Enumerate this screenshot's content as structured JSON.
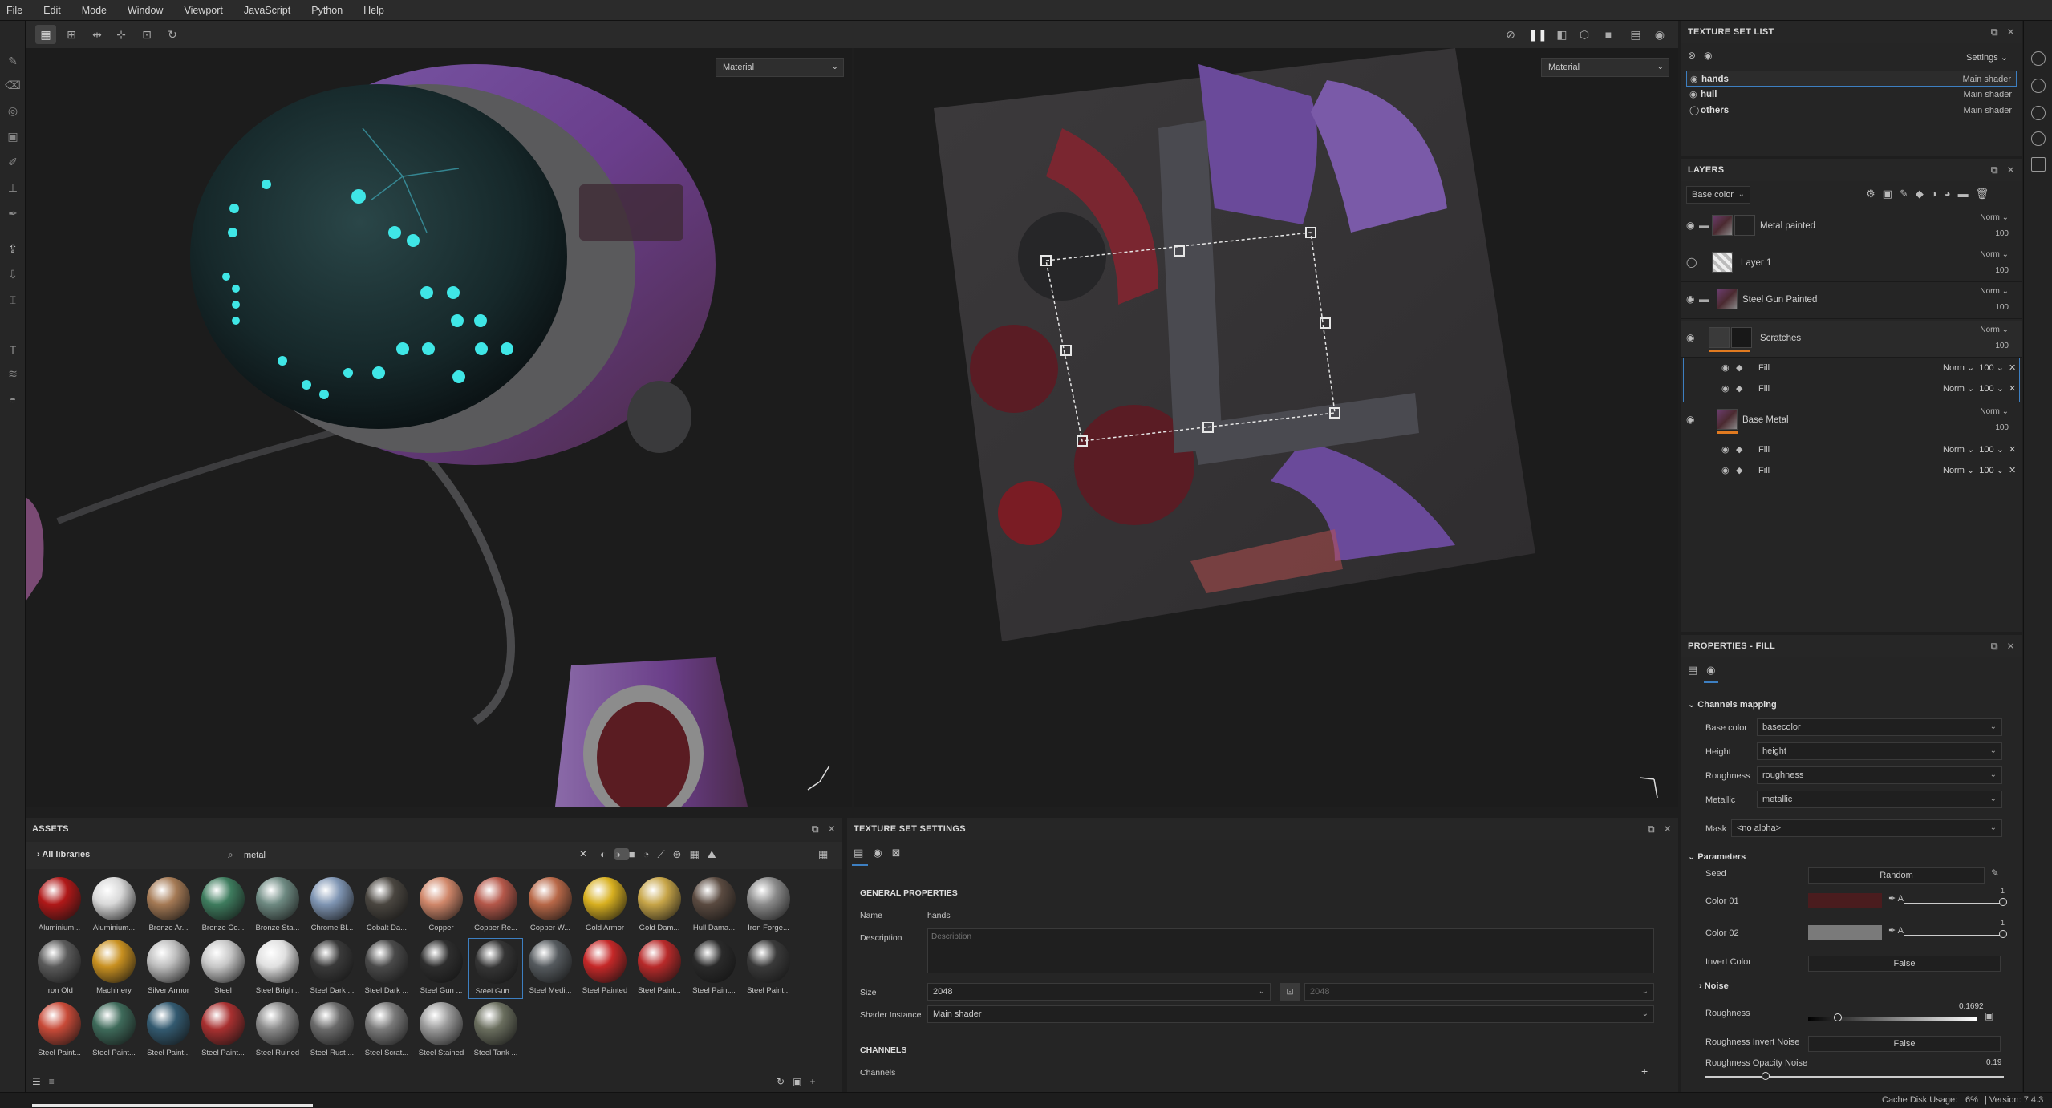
{
  "menu": [
    "File",
    "Edit",
    "Mode",
    "Window",
    "Viewport",
    "JavaScript",
    "Python",
    "Help"
  ],
  "viewport": {
    "left_select": "Material",
    "right_select": "Material"
  },
  "texture_set_list": {
    "title": "TEXTURE SET LIST",
    "settings_label": "Settings",
    "sets": [
      {
        "name": "hands",
        "shader": "Main shader",
        "selected": true
      },
      {
        "name": "hull",
        "shader": "Main shader",
        "selected": false
      },
      {
        "name": "others",
        "shader": "Main shader",
        "selected": false
      }
    ]
  },
  "layers": {
    "title": "LAYERS",
    "channel_select": "Base color",
    "items": [
      {
        "name": "Metal painted",
        "blend": "Norm",
        "opacity": "100"
      },
      {
        "name": "Layer 1",
        "blend": "Norm",
        "opacity": "100"
      },
      {
        "name": "Steel Gun Painted",
        "blend": "Norm",
        "opacity": "100"
      },
      {
        "name": "Scratches",
        "blend": "Norm",
        "opacity": "100"
      },
      {
        "name": "Base Metal",
        "blend": "Norm",
        "opacity": "100"
      }
    ],
    "scratches_fills": [
      {
        "name": "Fill",
        "blend": "Norm",
        "opacity": "100"
      },
      {
        "name": "Fill",
        "blend": "Norm",
        "opacity": "100"
      }
    ],
    "base_fills": [
      {
        "name": "Fill",
        "blend": "Norm",
        "opacity": "100"
      },
      {
        "name": "Fill",
        "blend": "Norm",
        "opacity": "100"
      }
    ]
  },
  "properties": {
    "title": "PROPERTIES - FILL",
    "channels_mapping_title": "Channels mapping",
    "mapping": [
      {
        "label": "Base color",
        "value": "basecolor"
      },
      {
        "label": "Height",
        "value": "height"
      },
      {
        "label": "Roughness",
        "value": "roughness"
      },
      {
        "label": "Metallic",
        "value": "metallic"
      }
    ],
    "mask_label": "Mask",
    "mask_value": "<no alpha>",
    "parameters_title": "Parameters",
    "seed_label": "Seed",
    "seed_value": "Random",
    "color01_label": "Color 01",
    "color01": "#4a1c1e",
    "color02_label": "Color 02",
    "color02": "#7a7a7a",
    "alpha_label": "A",
    "alpha_max": "1",
    "invert_color_label": "Invert Color",
    "invert_color_value": "False",
    "noise_label": "Noise",
    "roughness_label": "Roughness",
    "roughness_value": "0.1692",
    "roughness_invert_label": "Roughness Invert Noise",
    "roughness_invert_value": "False",
    "roughness_opacity_label": "Roughness Opacity Noise",
    "roughness_opacity_value": "0.19"
  },
  "assets": {
    "title": "ASSETS",
    "library": "All libraries",
    "search_value": "metal",
    "materials": [
      {
        "label": "Aluminium...",
        "color": "#b01818"
      },
      {
        "label": "Aluminium...",
        "color": "#d8d8d8"
      },
      {
        "label": "Bronze Ar...",
        "color": "#a57a55"
      },
      {
        "label": "Bronze Co...",
        "color": "#3e7c5e"
      },
      {
        "label": "Bronze Sta...",
        "color": "#6e8a82"
      },
      {
        "label": "Chrome Bl...",
        "color": "#7f95b3"
      },
      {
        "label": "Cobalt Da...",
        "color": "#4a4640"
      },
      {
        "label": "Copper",
        "color": "#d0876a"
      },
      {
        "label": "Copper Re...",
        "color": "#b5584a"
      },
      {
        "label": "Copper W...",
        "color": "#b86848"
      },
      {
        "label": "Gold Armor",
        "color": "#d8b020"
      },
      {
        "label": "Gold Dam...",
        "color": "#c7a548"
      },
      {
        "label": "Hull Dama...",
        "color": "#5a4a40"
      },
      {
        "label": "Iron Forge...",
        "color": "#8a8a8a"
      },
      {
        "label": "Iron Old",
        "color": "#5a5a5a"
      },
      {
        "label": "Machinery",
        "color": "#c89020"
      },
      {
        "label": "Silver Armor",
        "color": "#bdbdbd"
      },
      {
        "label": "Steel",
        "color": "#c7c7c7"
      },
      {
        "label": "Steel Brigh...",
        "color": "#e0e0e0"
      },
      {
        "label": "Steel Dark ...",
        "color": "#3a3a3a"
      },
      {
        "label": "Steel Dark ...",
        "color": "#4a4a4a"
      },
      {
        "label": "Steel Gun ...",
        "color": "#2e2e2e"
      },
      {
        "label": "Steel Gun ...",
        "color": "#353535"
      },
      {
        "label": "Steel Medi...",
        "color": "#555a5e"
      },
      {
        "label": "Steel Painted",
        "color": "#c52828"
      },
      {
        "label": "Steel Paint...",
        "color": "#b82a2a"
      },
      {
        "label": "Steel Paint...",
        "color": "#2a2a2a"
      },
      {
        "label": "Steel Paint...",
        "color": "#3a3a3a"
      },
      {
        "label": "Steel Paint...",
        "color": "#c84a38"
      },
      {
        "label": "Steel Paint...",
        "color": "#3e6a5a"
      },
      {
        "label": "Steel Paint...",
        "color": "#335a70"
      },
      {
        "label": "Steel Paint...",
        "color": "#a83030"
      },
      {
        "label": "Steel Ruined",
        "color": "#8a8a8a"
      },
      {
        "label": "Steel Rust ...",
        "color": "#6a6a6a"
      },
      {
        "label": "Steel Scrat...",
        "color": "#7a7a7a"
      },
      {
        "label": "Steel Stained",
        "color": "#9a9a9a"
      },
      {
        "label": "Steel Tank ...",
        "color": "#6a6e5e"
      }
    ]
  },
  "texture_set_settings": {
    "title": "TEXTURE SET SETTINGS",
    "general_title": "GENERAL PROPERTIES",
    "name_label": "Name",
    "name_value": "hands",
    "description_label": "Description",
    "description_placeholder": "Description",
    "size_label": "Size",
    "size_value": "2048",
    "size_value2": "2048",
    "shader_label": "Shader Instance",
    "shader_value": "Main shader",
    "channels_title": "CHANNELS",
    "channels_label": "Channels"
  },
  "status": {
    "cache_label": "Cache Disk Usage:",
    "cache_value": "6%",
    "version": "| Version: 7.4.3"
  }
}
